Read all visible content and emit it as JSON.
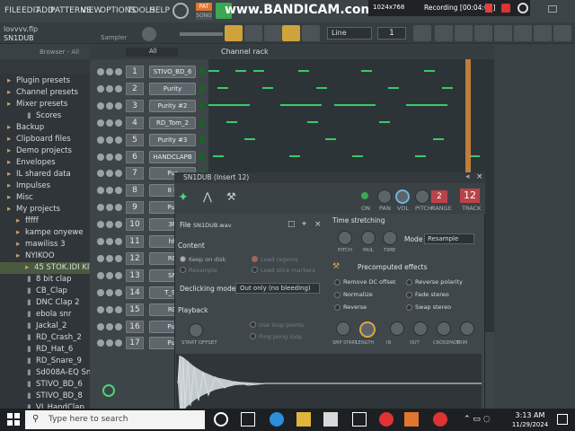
{
  "menu": [
    "FILE",
    "EDIT",
    "ADD",
    "PATTERNS",
    "VIEW",
    "OPTIONS",
    "TOOLS",
    "HELP"
  ],
  "topbar": {
    "pat": "PAT",
    "song": "SONG",
    "bandicam": "www.BANDICAM.com",
    "resolution": "1024x768",
    "recording": "Recording [00:04:05]"
  },
  "title": {
    "file": "lovvvv.flp",
    "channel": "SN1DUB",
    "sampler": "Sampler",
    "line": "Line",
    "step": "1"
  },
  "browser": {
    "title": "Browser - All",
    "items": [
      {
        "label": "Plugin presets",
        "type": "folder"
      },
      {
        "label": "Channel presets",
        "type": "folder"
      },
      {
        "label": "Mixer presets",
        "type": "folder"
      },
      {
        "label": "Scores",
        "type": "file"
      },
      {
        "label": "Backup",
        "type": "folder"
      },
      {
        "label": "Clipboard files",
        "type": "folder"
      },
      {
        "label": "Demo projects",
        "type": "folder"
      },
      {
        "label": "Envelopes",
        "type": "folder"
      },
      {
        "label": "IL shared data",
        "type": "folder"
      },
      {
        "label": "Impulses",
        "type": "folder"
      },
      {
        "label": "Misc",
        "type": "folder"
      },
      {
        "label": "My projects",
        "type": "folder"
      },
      {
        "label": "fffff",
        "type": "sub"
      },
      {
        "label": "kampe onyewe",
        "type": "sub"
      },
      {
        "label": "mawiliss 3",
        "type": "sub"
      },
      {
        "label": "NYIKOO",
        "type": "sub"
      },
      {
        "label": "45 STOK.IDI KIT",
        "type": "sub2"
      },
      {
        "label": "8 bit clap",
        "type": "file"
      },
      {
        "label": "CB_Clap",
        "type": "file"
      },
      {
        "label": "DNC Clap 2",
        "type": "file"
      },
      {
        "label": "ebola snr",
        "type": "file"
      },
      {
        "label": "Jackal_2",
        "type": "file"
      },
      {
        "label": "RD_Crash_2",
        "type": "file"
      },
      {
        "label": "RD_Hat_6",
        "type": "file"
      },
      {
        "label": "RD_Snare_9",
        "type": "file"
      },
      {
        "label": "Sd008A-EQ Snare",
        "type": "file"
      },
      {
        "label": "STIVO_BD_6",
        "type": "file"
      },
      {
        "label": "STIVO_BD_8",
        "type": "file"
      },
      {
        "label": "VI_HandClap",
        "type": "file"
      }
    ]
  },
  "rack": {
    "filter": "All",
    "title": "Channel rack",
    "channels": [
      {
        "num": "1",
        "name": "STIVO_BD_6"
      },
      {
        "num": "2",
        "name": "Purity"
      },
      {
        "num": "3",
        "name": "Purity #2"
      },
      {
        "num": "4",
        "name": "RD_Tom_2"
      },
      {
        "num": "5",
        "name": "Purity #3"
      },
      {
        "num": "6",
        "name": "HANDCLAPB"
      },
      {
        "num": "7",
        "name": "Pur"
      },
      {
        "num": "8",
        "name": "8 b"
      },
      {
        "num": "9",
        "name": "Pur"
      },
      {
        "num": "10",
        "name": "3R"
      },
      {
        "num": "11",
        "name": "hh"
      },
      {
        "num": "12",
        "name": "RD"
      },
      {
        "num": "13",
        "name": "SN"
      },
      {
        "num": "14",
        "name": "T_SO"
      },
      {
        "num": "15",
        "name": "RD"
      },
      {
        "num": "16",
        "name": "Pur"
      },
      {
        "num": "17",
        "name": "Pur"
      }
    ]
  },
  "plugin": {
    "title": "SN1DUB (Insert 12)",
    "labels": {
      "on": "ON",
      "pan": "PAN",
      "vol": "VOL",
      "pitch": "PITCH",
      "range": "RANGE",
      "track": "TRACK"
    },
    "range_value": "2",
    "track_value": "12",
    "file_label": "File",
    "file_name": "SN1DUB.wav",
    "content": "Content",
    "keep_on_disk": "Keep on disk",
    "resample": "Resample",
    "load_regions": "Load regions",
    "load_slice": "Load slice markers",
    "declick_label": "Declicking mode",
    "declick_value": "Out only (no bleeding)",
    "playback": "Playback",
    "start_offset": "START OFFSET",
    "use_loop": "Use loop points",
    "ping_pong": "Ping pong loop",
    "time_stretch": "Time stretching",
    "ts_pitch": "PITCH",
    "ts_mul": "MUL",
    "ts_time": "TIME",
    "mode_label": "Mode",
    "mode_value": "Resample",
    "precomputed": "Precomputed effects",
    "fx": [
      "Remove DC offset",
      "Reverse polarity",
      "Normalize",
      "Fade stereo",
      "Reverse",
      "Swap stereo"
    ],
    "knobs": [
      "SMP START",
      "LENGTH",
      "IN",
      "OUT",
      "CROSSFADE",
      "TRIM"
    ]
  },
  "taskbar": {
    "search": "Type here to search",
    "time": "3:13 AM",
    "date": "11/29/2024"
  }
}
